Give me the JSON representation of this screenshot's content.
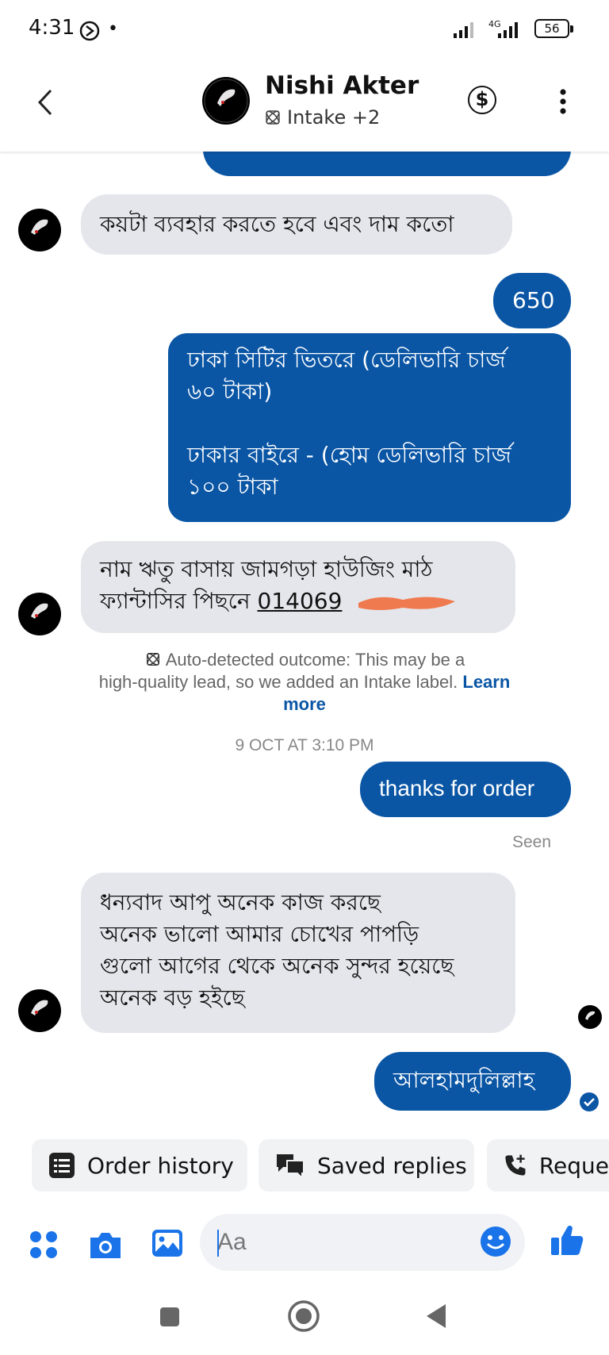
{
  "status_bar": {
    "time": "4:31",
    "network": "4G",
    "battery": "56"
  },
  "header": {
    "contact_name": "Nishi Akter",
    "subtitle": "Intake +2",
    "icons": [
      "back-icon",
      "dollar-icon",
      "more-vertical-icon"
    ]
  },
  "messages": [
    {
      "from": "me",
      "text": ""
    },
    {
      "from": "contact",
      "text": "কয়টা ব্যবহার করতে হবে এবং দাম কতো"
    },
    {
      "from": "me",
      "text": "650"
    },
    {
      "from": "me",
      "line1": "ঢাকা সিটির ভিতরে (ডেলিভারি চার্জ",
      "line2": "৬০ টাকা)",
      "line3": "ঢাকার বাইরে - (হোম ডেলিভারি চার্জ",
      "line4": "১০০ টাকা"
    },
    {
      "from": "contact",
      "line1": "নাম ঋতু বাসায়  জামগড়া হাউজিং মাঠ",
      "line2": "ফ্যান্টাসির পিছনে ",
      "phone": "014069"
    },
    {
      "from": "contact",
      "line1": "ধন্যবাদ আপু অনেক কাজ করছে",
      "line2": "অনেক ভালো আমার চোখের পাপড়ি",
      "line3": "গুলো আগের থেকে অনেক সুন্দর হয়েছে",
      "line4": "অনেক বড় হইছে"
    },
    {
      "from": "me",
      "text": "আলহামদুলিল্লাহ"
    }
  ],
  "notice": {
    "text1": "Auto-detected outcome: This may be a",
    "text2": "high-quality lead, so we added an Intake label.",
    "learn_1": "Learn",
    "learn_2": "more"
  },
  "timestamp": "9 OCT AT 3:10 PM",
  "thanks_message": "thanks for order",
  "seen_label": "Seen",
  "quick_replies": [
    "Order history",
    "Saved replies",
    "Reque"
  ],
  "composer": {
    "placeholder": "Aa"
  },
  "colors": {
    "accent": "#0a56a5",
    "incoming_bg": "#e4e6eb",
    "messenger_blue": "#1a73e8",
    "redaction": "#f07a4f"
  }
}
